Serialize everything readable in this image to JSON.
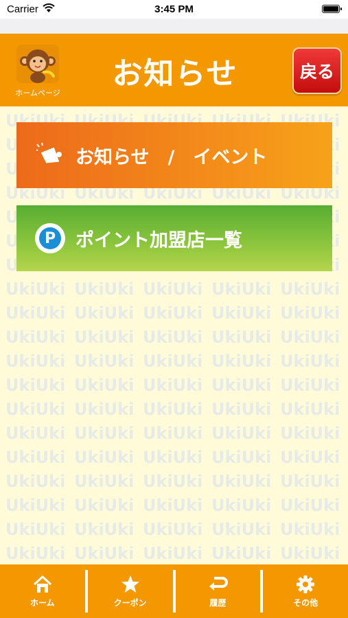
{
  "status_bar": {
    "carrier": "Carrier",
    "time": "3:45 PM"
  },
  "header": {
    "title": "お知らせ",
    "home_label": "ホームページ",
    "back_label": "戻る"
  },
  "watermark": {
    "text": "UkiUki"
  },
  "menu": [
    {
      "label": "お知らせ　/　イベント",
      "icon": "megaphone-icon",
      "color": "#ed6a1a"
    },
    {
      "label": "ポイント加盟店一覧",
      "icon": "parking-p-icon",
      "icon_letter": "P",
      "color": "#57ad31"
    }
  ],
  "tabs": [
    {
      "label": "ホーム",
      "icon": "home-icon"
    },
    {
      "label": "クーポン",
      "icon": "star-icon"
    },
    {
      "label": "履歴",
      "icon": "return-arrow-icon"
    },
    {
      "label": "その他",
      "icon": "gear-icon"
    }
  ],
  "colors": {
    "accent": "#f39800",
    "background": "#fffbd9",
    "back_button": "#d81414",
    "icon_blue": "#1a8fd8"
  }
}
